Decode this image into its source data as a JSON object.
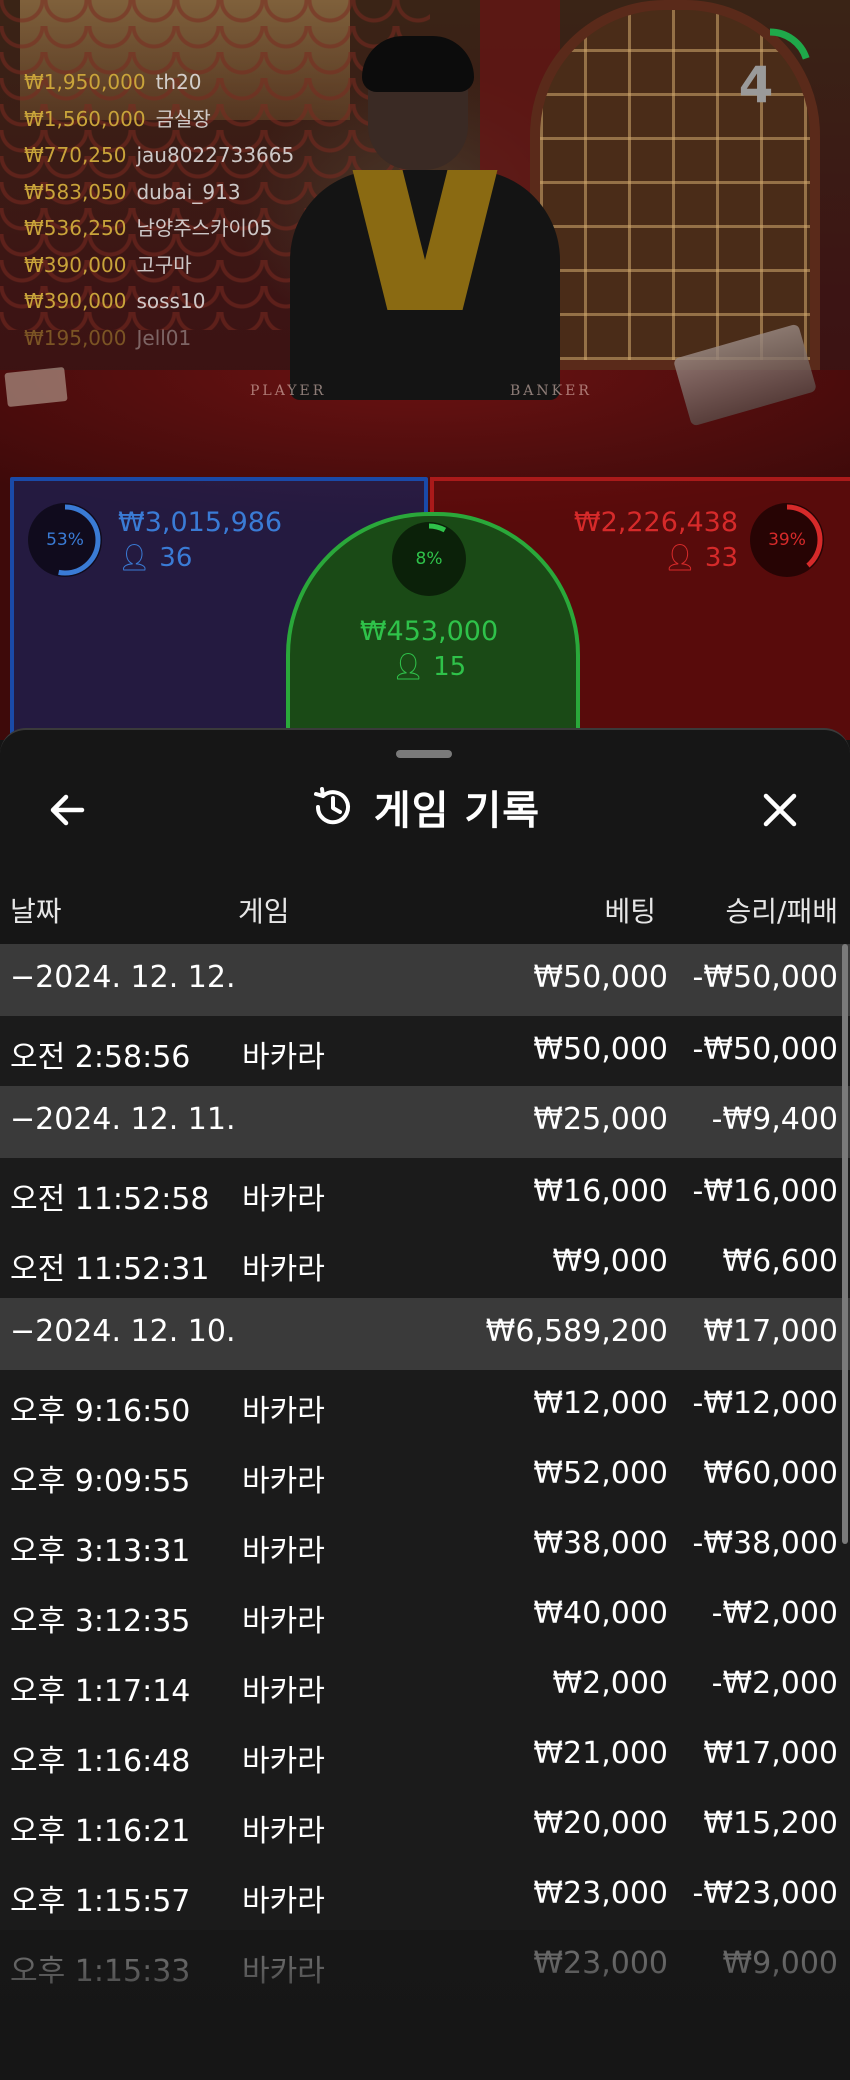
{
  "stream": {
    "table_labels": {
      "player": "PLAYER",
      "banker": "BANKER"
    },
    "leaderboard": [
      {
        "amount": "₩1,950,000",
        "name": "th20"
      },
      {
        "amount": "₩1,560,000",
        "name": "금실장"
      },
      {
        "amount": "₩770,250",
        "name": "jau8022733665"
      },
      {
        "amount": "₩583,050",
        "name": "dubai_913"
      },
      {
        "amount": "₩536,250",
        "name": "남양주스카이05"
      },
      {
        "amount": "₩390,000",
        "name": "고구마"
      },
      {
        "amount": "₩390,000",
        "name": "soss10"
      },
      {
        "amount": "₩195,000",
        "name": "Jell01"
      }
    ],
    "countdown": {
      "value": "4",
      "progress": 0.2,
      "color": "#1fa84a"
    },
    "bets": {
      "player": {
        "percent": "53%",
        "percent_value": 0.53,
        "amount": "₩3,015,986",
        "players": "36",
        "color": "#3a7bd5"
      },
      "tie": {
        "percent": "8%",
        "percent_value": 0.08,
        "amount": "₩453,000",
        "players": "15",
        "color": "#2fc24a"
      },
      "banker": {
        "percent": "39%",
        "percent_value": 0.39,
        "amount": "₩2,226,438",
        "players": "33",
        "color": "#d62a2a"
      }
    }
  },
  "history": {
    "title": "게임 기록",
    "icons": {
      "back": "arrow-left-icon",
      "title": "history-clock-icon",
      "close": "close-icon"
    },
    "columns": {
      "date": "날짜",
      "game": "게임",
      "bet": "베팅",
      "win_loss": "승리/패배"
    },
    "rows": [
      {
        "type": "date",
        "date": "−2024. 12. 12.",
        "bet": "₩50,000",
        "win_loss": "-₩50,000"
      },
      {
        "type": "game",
        "date": "오전 2:58:56",
        "game": "바카라",
        "bet": "₩50,000",
        "win_loss": "-₩50,000"
      },
      {
        "type": "date",
        "date": "−2024. 12. 11.",
        "bet": "₩25,000",
        "win_loss": "-₩9,400"
      },
      {
        "type": "game",
        "date": "오전 11:52:58",
        "game": "바카라",
        "bet": "₩16,000",
        "win_loss": "-₩16,000"
      },
      {
        "type": "game",
        "date": "오전 11:52:31",
        "game": "바카라",
        "bet": "₩9,000",
        "win_loss": "₩6,600"
      },
      {
        "type": "date",
        "date": "−2024. 12. 10.",
        "bet": "₩6,589,200",
        "win_loss": "₩17,000"
      },
      {
        "type": "game",
        "date": "오후 9:16:50",
        "game": "바카라",
        "bet": "₩12,000",
        "win_loss": "-₩12,000"
      },
      {
        "type": "game",
        "date": "오후 9:09:55",
        "game": "바카라",
        "bet": "₩52,000",
        "win_loss": "₩60,000"
      },
      {
        "type": "game",
        "date": "오후 3:13:31",
        "game": "바카라",
        "bet": "₩38,000",
        "win_loss": "-₩38,000"
      },
      {
        "type": "game",
        "date": "오후 3:12:35",
        "game": "바카라",
        "bet": "₩40,000",
        "win_loss": "-₩2,000"
      },
      {
        "type": "game",
        "date": "오후 1:17:14",
        "game": "바카라",
        "bet": "₩2,000",
        "win_loss": "-₩2,000"
      },
      {
        "type": "game",
        "date": "오후 1:16:48",
        "game": "바카라",
        "bet": "₩21,000",
        "win_loss": "₩17,000"
      },
      {
        "type": "game",
        "date": "오후 1:16:21",
        "game": "바카라",
        "bet": "₩20,000",
        "win_loss": "₩15,200"
      },
      {
        "type": "game",
        "date": "오후 1:15:57",
        "game": "바카라",
        "bet": "₩23,000",
        "win_loss": "-₩23,000"
      },
      {
        "type": "game",
        "date": "오후 1:15:33",
        "game": "바카라",
        "bet": "₩23,000",
        "win_loss": "₩9,000"
      }
    ]
  }
}
